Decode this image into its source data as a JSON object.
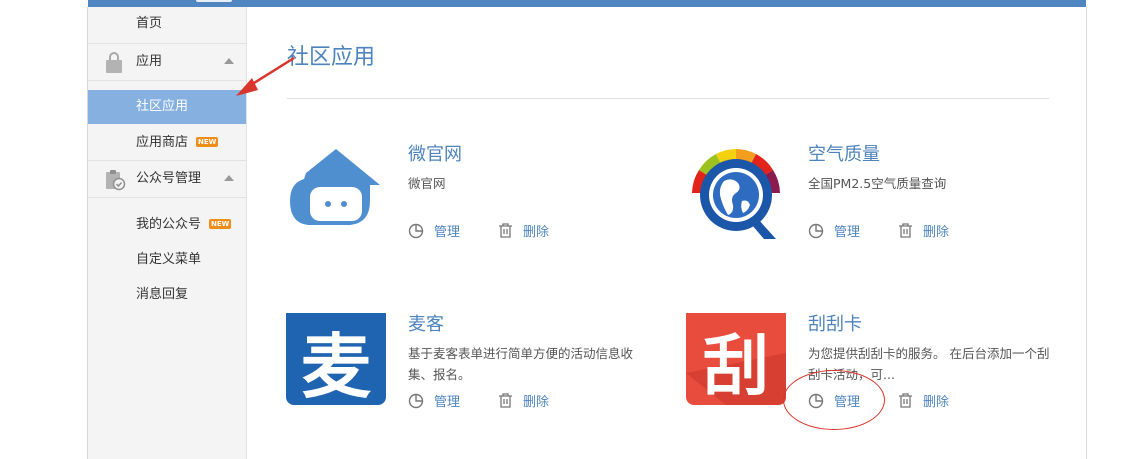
{
  "sidebar": {
    "home": "首页",
    "apps_group": "应用",
    "community_apps": "社区应用",
    "app_store": "应用商店",
    "new_badge": "NEW",
    "official_group": "公众号管理",
    "my_accounts": "我的公众号",
    "custom_menu": "自定义菜单",
    "message_reply": "消息回复"
  },
  "main": {
    "title": "社区应用",
    "cards": [
      {
        "name": "微官网",
        "desc": "微官网",
        "icon": "cloud-face-icon"
      },
      {
        "name": "空气质量",
        "desc": "全国PM2.5空气质量查询",
        "icon": "air-quality-globe-icon"
      },
      {
        "name": "麦客",
        "desc": "基于麦客表单进行简单方便的活动信息收集、报名。",
        "icon": "mai-icon",
        "icon_text": "麦"
      },
      {
        "name": "刮刮卡",
        "desc": "为您提供刮刮卡的服务。 在后台添加一个刮刮卡活动，可...",
        "icon": "scratch-card-icon",
        "icon_text": "刮"
      }
    ],
    "manage_label": "管理",
    "delete_label": "删除"
  },
  "colors": {
    "topbar": "#4f86c2",
    "accent": "#4d84bd",
    "active_item": "#85b0e0",
    "annotation": "#d9362b",
    "new_badge": "#f08c1a"
  }
}
